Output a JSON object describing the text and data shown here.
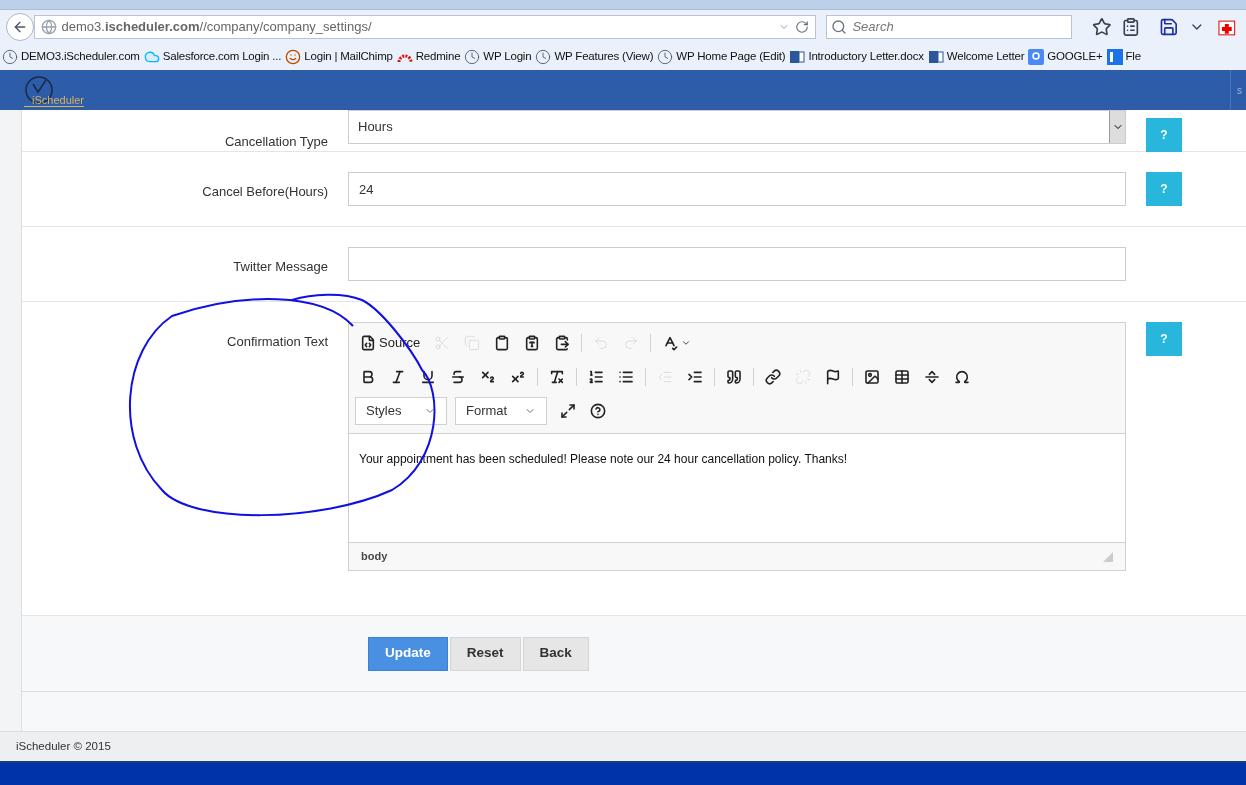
{
  "browser": {
    "url": "demo3.**ischeduler.com**//company/company_settings/",
    "search": {
      "placeholder": "Search"
    },
    "bookmarks": [
      {
        "label": "DEMO3.iScheduler.com",
        "kind": "clock"
      },
      {
        "label": "Salesforce.com Login ...",
        "kind": "cloud"
      },
      {
        "label": "Login | MailChimp",
        "kind": "chimp"
      },
      {
        "label": "Redmine",
        "kind": "arc"
      },
      {
        "label": "WP Login",
        "kind": "clock"
      },
      {
        "label": "WP Features (View)",
        "kind": "clock"
      },
      {
        "label": "WP Home Page (Edit)",
        "kind": "clock"
      },
      {
        "label": "Introductory Letter.docx",
        "kind": "word"
      },
      {
        "label": "Welcome Letter",
        "kind": "word"
      },
      {
        "label": "GOOGLE+",
        "kind": "google"
      },
      {
        "label": "Fle",
        "kind": "fb"
      }
    ]
  },
  "header": {
    "logo": "iScheduler",
    "edge_text": "s"
  },
  "form": {
    "rows": [
      {
        "label": "Cancellation Type",
        "kind": "select",
        "value": "Hours",
        "help": "?"
      },
      {
        "label": "Cancel Before(Hours)",
        "kind": "input",
        "value": "24",
        "help": "?"
      },
      {
        "label": "Twitter Message",
        "kind": "input",
        "value": ""
      },
      {
        "label": "Confirmation Text",
        "kind": "editor",
        "help": "?"
      }
    ]
  },
  "editor": {
    "toolbar_rows": [
      [
        {
          "kind": "button",
          "label": "Source",
          "disabled": false
        },
        {
          "kind": "button",
          "disabled": true
        },
        {
          "kind": "button",
          "disabled": true
        },
        {
          "kind": "button",
          "disabled": false
        },
        {
          "kind": "button",
          "disabled": false
        },
        {
          "kind": "button",
          "disabled": false
        },
        {
          "kind": "separator"
        },
        {
          "kind": "button",
          "disabled": true
        },
        {
          "kind": "button",
          "disabled": true
        },
        {
          "kind": "separator"
        },
        {
          "kind": "menu",
          "disabled": false
        }
      ],
      [
        {
          "kind": "button",
          "disabled": false
        },
        {
          "kind": "button",
          "disabled": false
        },
        {
          "kind": "button",
          "disabled": false
        },
        {
          "kind": "button",
          "disabled": false
        },
        {
          "kind": "button",
          "disabled": false
        },
        {
          "kind": "button",
          "disabled": false
        },
        {
          "kind": "separator"
        },
        {
          "kind": "button",
          "disabled": false
        },
        {
          "kind": "separator"
        },
        {
          "kind": "button",
          "disabled": false
        },
        {
          "kind": "button",
          "disabled": false
        },
        {
          "kind": "separator"
        },
        {
          "kind": "button",
          "disabled": true
        },
        {
          "kind": "button",
          "disabled": false
        },
        {
          "kind": "separator"
        },
        {
          "kind": "button",
          "disabled": false
        },
        {
          "kind": "separator"
        },
        {
          "kind": "button",
          "disabled": false
        },
        {
          "kind": "button",
          "disabled": true
        },
        {
          "kind": "button",
          "disabled": false
        },
        {
          "kind": "separator"
        },
        {
          "kind": "button",
          "disabled": false
        },
        {
          "kind": "button",
          "disabled": false
        },
        {
          "kind": "button",
          "disabled": false
        },
        {
          "kind": "button",
          "disabled": false
        }
      ],
      [
        {
          "kind": "dropdown",
          "label": "Styles"
        },
        {
          "kind": "dropdown",
          "label": "Format"
        },
        {
          "kind": "button",
          "disabled": false
        },
        {
          "kind": "button",
          "disabled": false
        }
      ]
    ],
    "content": "Your appointment has been scheduled! Please note our 24 hour cancellation policy. Thanks!",
    "path": "body"
  },
  "actions": [
    {
      "label": "Update",
      "primary": true
    },
    {
      "label": "Reset",
      "primary": false
    },
    {
      "label": "Back",
      "primary": false
    }
  ],
  "footer": "iScheduler © 2015"
}
